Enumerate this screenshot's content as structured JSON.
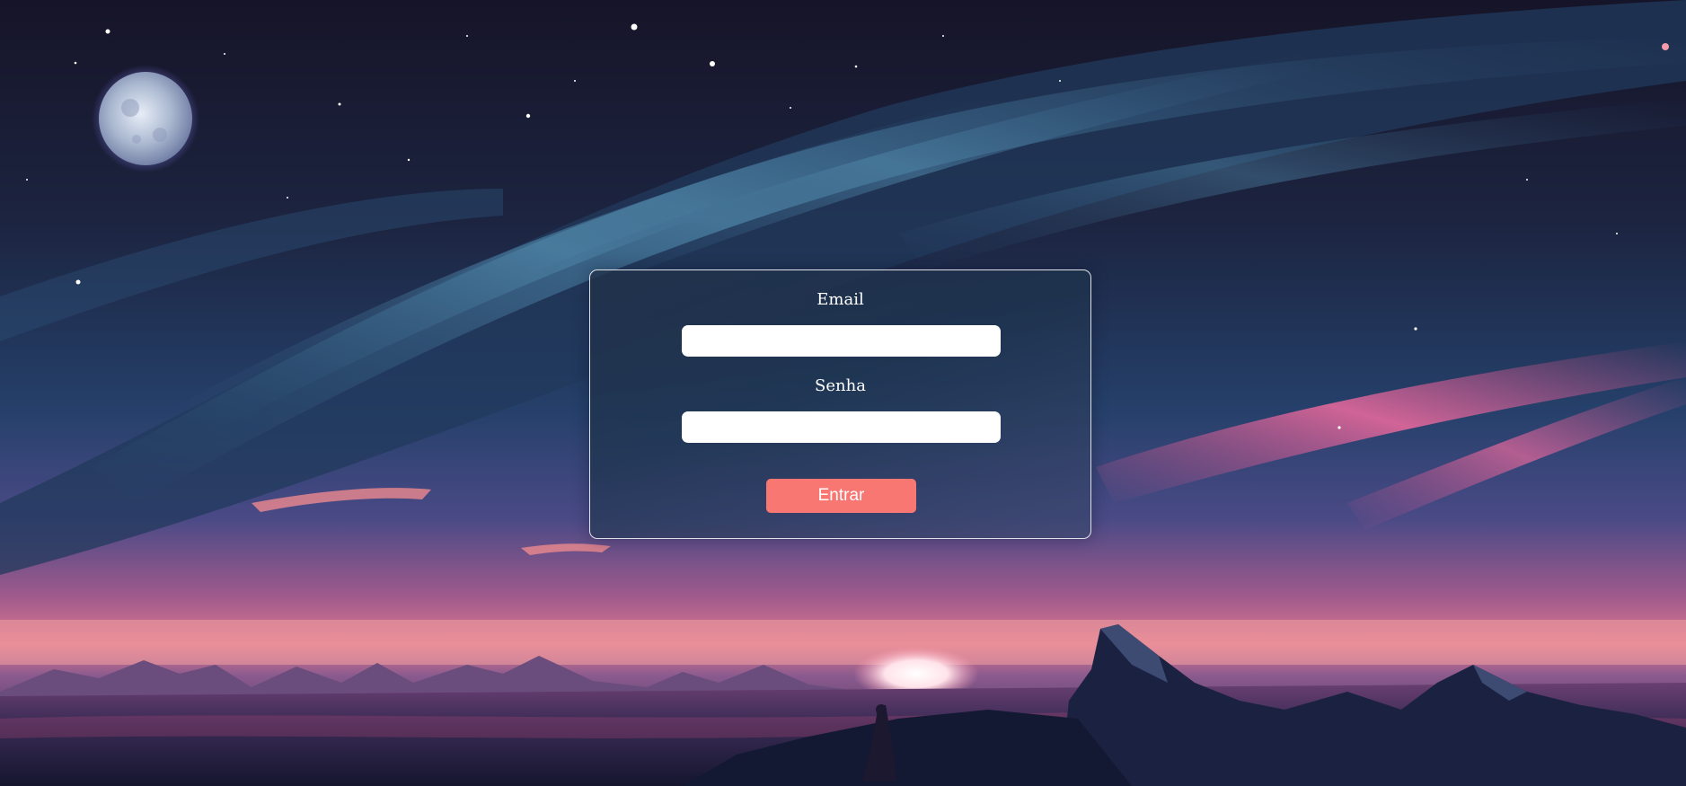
{
  "login": {
    "email_label": "Email",
    "email_value": "",
    "senha_label": "Senha",
    "senha_value": "",
    "submit_label": "Entrar"
  },
  "colors": {
    "button_background": "#f87772",
    "card_border": "#ffffff",
    "input_background": "#ffffff"
  },
  "background": {
    "description_icon": "night-landscape-moon-background"
  }
}
